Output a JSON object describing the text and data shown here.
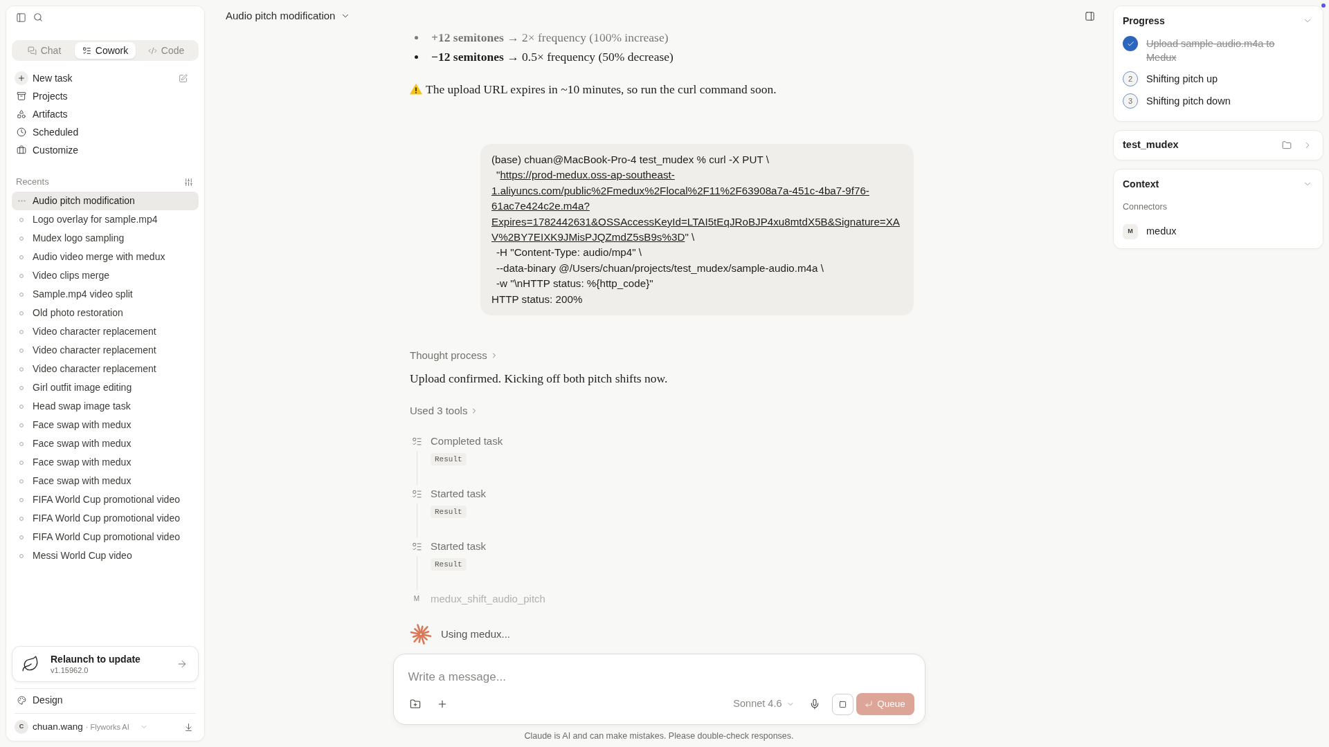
{
  "sidebar": {
    "tabs": [
      {
        "label": "Chat",
        "selected": false
      },
      {
        "label": "Cowork",
        "selected": true
      },
      {
        "label": "Code",
        "selected": false
      }
    ],
    "nav": [
      {
        "label": "New task"
      },
      {
        "label": "Projects"
      },
      {
        "label": "Artifacts"
      },
      {
        "label": "Scheduled"
      },
      {
        "label": "Customize"
      }
    ],
    "recents": {
      "title": "Recents",
      "items": [
        {
          "label": "Audio pitch modification",
          "selected": true,
          "running": true
        },
        {
          "label": "Logo overlay for sample.mp4",
          "selected": false,
          "running": false
        },
        {
          "label": "Mudex logo sampling",
          "selected": false,
          "running": false
        },
        {
          "label": "Audio video merge with medux",
          "selected": false,
          "running": false
        },
        {
          "label": "Video clips merge",
          "selected": false,
          "running": false
        },
        {
          "label": "Sample.mp4 video split",
          "selected": false,
          "running": false
        },
        {
          "label": "Old photo restoration",
          "selected": false,
          "running": false
        },
        {
          "label": "Video character replacement",
          "selected": false,
          "running": false
        },
        {
          "label": "Video character replacement",
          "selected": false,
          "running": false
        },
        {
          "label": "Video character replacement",
          "selected": false,
          "running": false
        },
        {
          "label": "Girl outfit image editing",
          "selected": false,
          "running": false
        },
        {
          "label": "Head swap image task",
          "selected": false,
          "running": false
        },
        {
          "label": "Face swap with medux",
          "selected": false,
          "running": false
        },
        {
          "label": "Face swap with medux",
          "selected": false,
          "running": false
        },
        {
          "label": "Face swap with medux",
          "selected": false,
          "running": false
        },
        {
          "label": "Face swap with medux",
          "selected": false,
          "running": false
        },
        {
          "label": "FIFA World Cup promotional video",
          "selected": false,
          "running": false
        },
        {
          "label": "FIFA World Cup promotional video",
          "selected": false,
          "running": false
        },
        {
          "label": "FIFA World Cup promotional video",
          "selected": false,
          "running": false
        },
        {
          "label": "Messi World Cup video",
          "selected": false,
          "running": false
        }
      ]
    },
    "update": {
      "title": "Relaunch to update",
      "version": "v1.15962.0"
    },
    "design": {
      "label": "Design"
    },
    "user": {
      "initial": "C",
      "name": "chuan.wang",
      "org": "· Flyworks AI"
    }
  },
  "header": {
    "title": "Audio pitch modification"
  },
  "conversation": {
    "bullets": [
      "**+12 semitones** → 2× frequency (100% increase)",
      "**−12 semitones** → 0.5× frequency (50% decrease)"
    ],
    "warning": "The upload URL expires in ~10 minutes, so run the curl command soon.",
    "user_message": {
      "lines": [
        {
          "kind": "command",
          "text": "(base) chuan@MacBook-Pro-4 test_mudex % curl -X PUT \\"
        },
        {
          "kind": "continuation",
          "prefix": "\"",
          "link": "https://prod-medux.oss-ap-southeast-1.aliyuncs.com/public%2Fmedux%2Flocal%2F11%2F63908a7a-451c-4ba7-9f76-61ac7e424c2e.m4a?Expires=1782442631&OSSAccessKeyId=LTAI5tEqJRoBJP4xu8mtdX5B&Signature=XAV%2BY7EIXK9JMisPJQZmdZ5sB9s%3D",
          "suffix": "\" \\"
        },
        {
          "kind": "continuation",
          "text": "-H \"Content-Type: audio/mp4\" \\"
        },
        {
          "kind": "continuation",
          "text": "--data-binary @/Users/chuan/projects/test_mudex/sample-audio.m4a \\"
        },
        {
          "kind": "continuation",
          "text": "-w \"\\nHTTP status: %{http_code}\""
        },
        {
          "kind": "output",
          "text": "HTTP status: 200%"
        }
      ]
    },
    "thought": "Thought process",
    "reply": "Upload confirmed. Kicking off both pitch shifts now.",
    "tools": {
      "summary": "Used 3 tools",
      "steps": [
        {
          "kind": "task",
          "label": "Completed task",
          "result": "Result"
        },
        {
          "kind": "task",
          "label": "Started task",
          "result": "Result"
        },
        {
          "kind": "task",
          "label": "Started task",
          "result": "Result"
        },
        {
          "kind": "connector",
          "badge": "M",
          "label": "medux_shift_audio_pitch"
        }
      ]
    },
    "status": "Using medux..."
  },
  "composer": {
    "placeholder": "Write a message...",
    "model": "Sonnet 4.6",
    "queue": {
      "label": "Queue",
      "disabled": true
    }
  },
  "disclaimer": "Claude is AI and can make mistakes. Please double-check responses.",
  "progress": {
    "title": "Progress",
    "expanded": true,
    "items": [
      {
        "label": "Upload sample-audio.m4a to Medux",
        "done": true
      },
      {
        "number": "2",
        "label": "Shifting pitch up",
        "done": false
      },
      {
        "number": "3",
        "label": "Shifting pitch down",
        "done": false
      }
    ]
  },
  "folder": {
    "name": "test_mudex"
  },
  "context": {
    "title": "Context",
    "expanded": true,
    "section": "Connectors",
    "connectors": [
      {
        "badge": "M",
        "name": "medux"
      }
    ]
  }
}
